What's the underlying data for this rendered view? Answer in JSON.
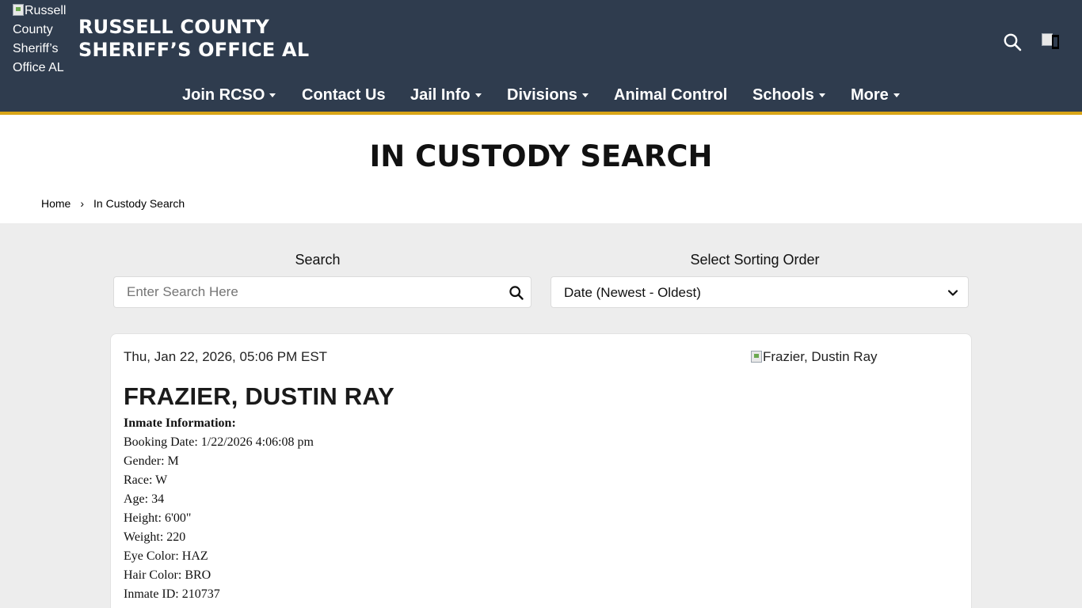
{
  "header": {
    "logo_alt": "Russell County Sheriff’s Office AL",
    "title_line1": "RUSSELL COUNTY",
    "title_line2": "SHERIFF’S OFFICE AL"
  },
  "nav": {
    "items": [
      {
        "label": "Join RCSO",
        "dropdown": true
      },
      {
        "label": "Contact Us",
        "dropdown": false
      },
      {
        "label": "Jail Info",
        "dropdown": true
      },
      {
        "label": "Divisions",
        "dropdown": true
      },
      {
        "label": "Animal Control",
        "dropdown": false
      },
      {
        "label": "Schools",
        "dropdown": true
      },
      {
        "label": "More",
        "dropdown": true
      }
    ]
  },
  "page": {
    "title": "IN CUSTODY SEARCH",
    "breadcrumb": {
      "home": "Home",
      "separator": "›",
      "current": "In Custody Search"
    }
  },
  "search": {
    "label": "Search",
    "placeholder": "Enter Search Here",
    "value": ""
  },
  "sort": {
    "label": "Select Sorting Order",
    "selected": "Date (Newest - Oldest)"
  },
  "inmate": {
    "date": "Thu, Jan 22, 2026, 05:06 PM EST",
    "photo_alt": "Frazier, Dustin Ray",
    "name": "FRAZIER, DUSTIN RAY",
    "info_heading": "Inmate Information:",
    "details": [
      "Booking Date: 1/22/2026 4:06:08 pm",
      "Gender: M",
      "Race: W",
      "Age: 34",
      "Height: 6'00\"",
      "Weight: 220",
      "Eye Color: HAZ",
      "Hair Color: BRO",
      "Inmate ID: 210737"
    ]
  },
  "colors": {
    "header_bg": "#2f3c4e",
    "accent_rule": "#d9a516",
    "page_bg": "#ededed"
  },
  "icons": [
    "search-icon",
    "flag-icon",
    "caret-down-icon",
    "chevron-down-icon",
    "broken-image-icon"
  ]
}
